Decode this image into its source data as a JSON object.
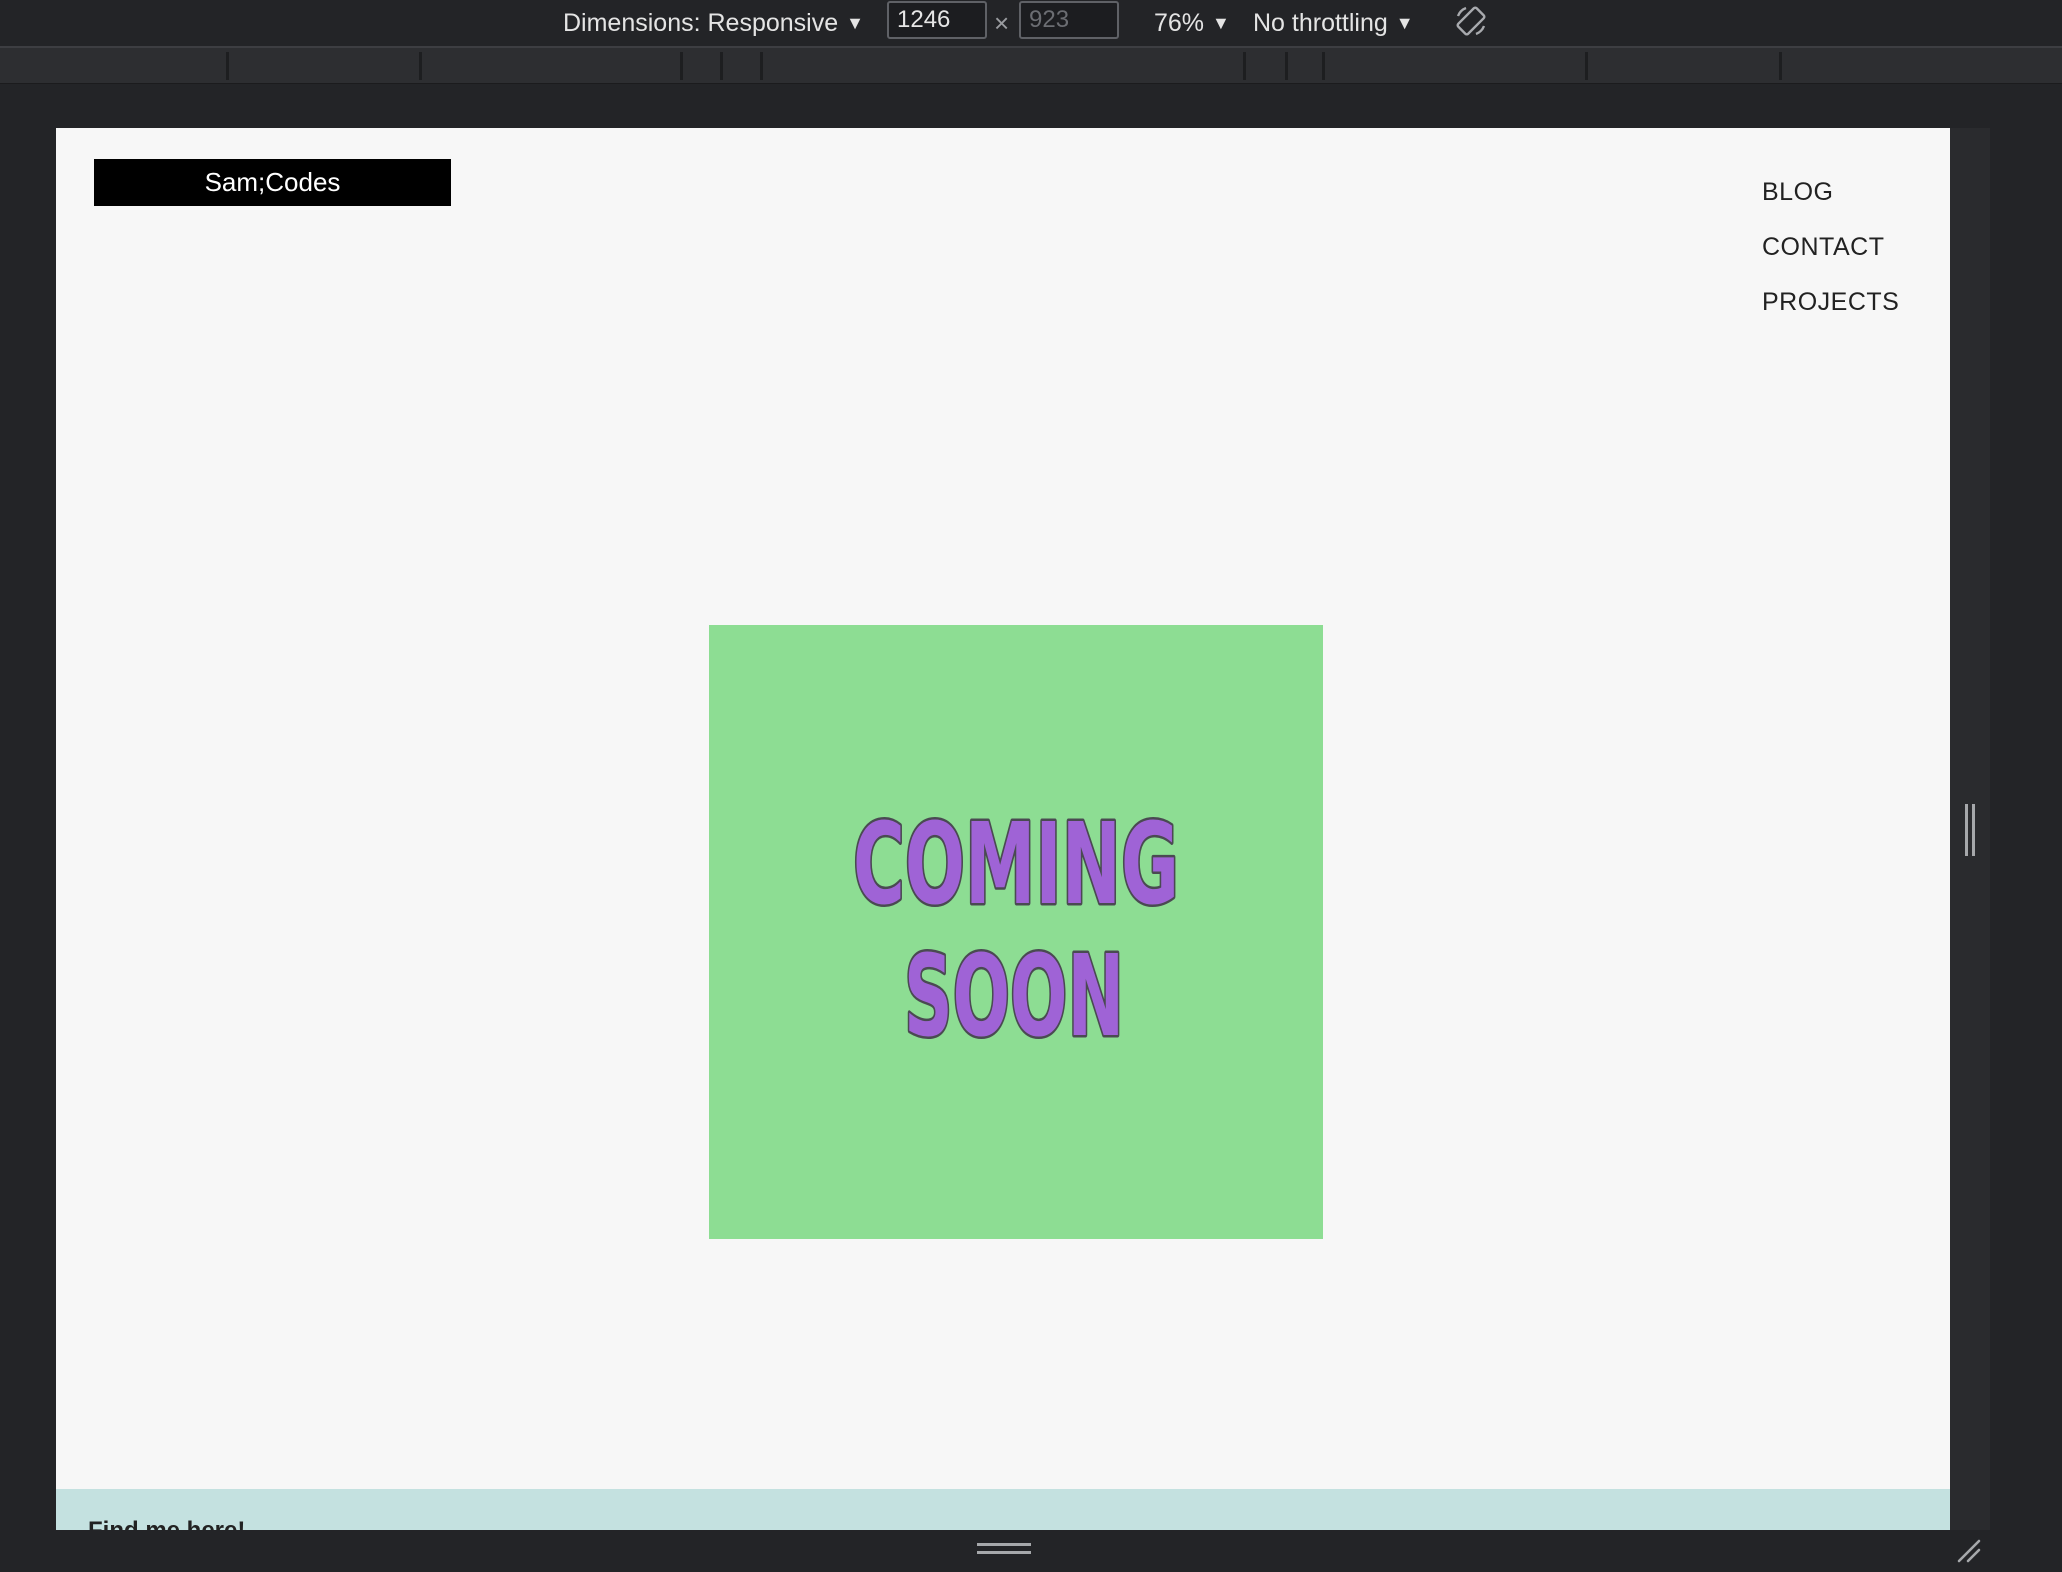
{
  "toolbar": {
    "dimensions_label": "Dimensions: Responsive",
    "width_value": "1246",
    "times_symbol": "×",
    "height_placeholder": "923",
    "zoom_label": "76%",
    "throttling_label": "No throttling",
    "rotate_icon": "rotate-icon",
    "caret_icon": "▼"
  },
  "site": {
    "logo_text": "Sam;Codes",
    "nav": [
      "BLOG",
      "CONTACT",
      "PROJECTS"
    ],
    "card": {
      "line1": "COMING",
      "line2": "SOON",
      "background_color": "#8ddd93",
      "text_color": "#9f63d6"
    },
    "footer_text": "Find me here!"
  },
  "colors": {
    "devtools_bg": "#232427",
    "page_bg": "#f7f7f7",
    "footer_bg": "#c4e1e0"
  }
}
